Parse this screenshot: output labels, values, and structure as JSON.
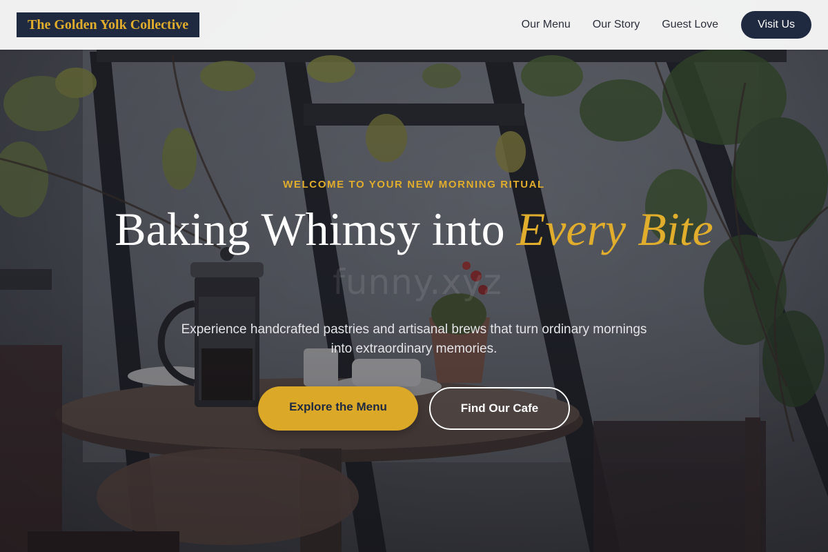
{
  "colors": {
    "navy": "#1f2a40",
    "gold": "#dba927",
    "gold_text": "#e0ad2c",
    "nav_background": "#f8f8f8",
    "white": "#ffffff"
  },
  "navbar": {
    "logo_text": "The Golden Yolk Collective",
    "links": [
      {
        "label": "Our Menu"
      },
      {
        "label": "Our Story"
      },
      {
        "label": "Guest Love"
      }
    ],
    "cta_label": "Visit Us"
  },
  "hero": {
    "eyebrow": "WELCOME TO YOUR NEW MORNING RITUAL",
    "headline_plain": "Baking Whimsy into",
    "headline_accent": "Every Bite",
    "subheadline": "Experience handcrafted pastries and artisanal brews that turn ordinary mornings into extraordinary memories.",
    "primary_button": "Explore the Menu",
    "secondary_button": "Find Our Cafe",
    "background_image": "cafe-table-french-press-plants-photo",
    "watermark": "funny.xyz"
  }
}
